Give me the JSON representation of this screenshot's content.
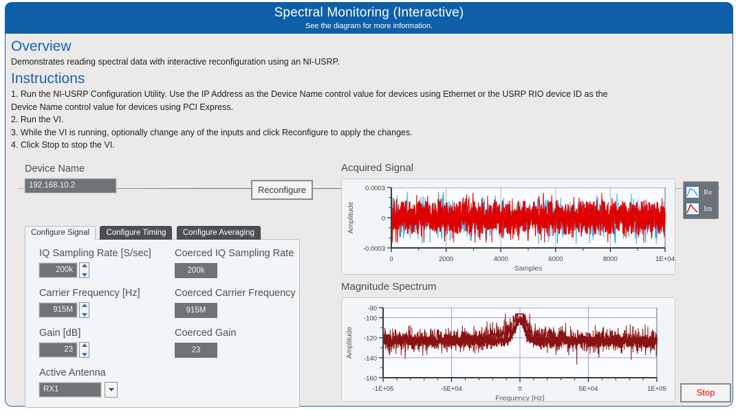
{
  "banner": {
    "title": "Spectral Monitoring (Interactive)",
    "subtitle": "See the diagram for more information."
  },
  "docs": {
    "overview_heading": "Overview",
    "overview_text": "Demonstrates reading spectral data with interactive reconfiguration using an NI-USRP.",
    "instructions_heading": "Instructions",
    "steps": [
      "1. Run the NI-USRP Configuration Utility. Use the IP Address as the Device Name control value for devices using Ethernet or the USRP RIO device ID as the",
      "Device Name control value for devices using PCI Express.",
      "2. Run the VI.",
      "3. While the VI is running, optionally change any of the inputs and click Reconfigure to apply the changes.",
      "4. Click Stop to stop the VI."
    ]
  },
  "controls": {
    "device_name_label": "Device Name",
    "device_name_value": "192.168.10.2",
    "reconfigure_label": "Reconfigure",
    "tabs": [
      {
        "label": "Configure Signal",
        "active": true
      },
      {
        "label": "Configure Timing",
        "active": false
      },
      {
        "label": "Configure Averaging",
        "active": false
      }
    ],
    "fields": [
      {
        "label": "IQ Sampling Rate [S/sec]",
        "value": "200k",
        "coerced_label": "Coerced IQ Sampling Rate",
        "coerced_value": "200k"
      },
      {
        "label": "Carrier Frequency [Hz]",
        "value": "915M",
        "coerced_label": "Coerced Carrier Frequency",
        "coerced_value": "915M"
      },
      {
        "label": "Gain [dB]",
        "value": "23",
        "coerced_label": "Coerced Gain",
        "coerced_value": "23"
      }
    ],
    "antenna_label": "Active Antenna",
    "antenna_value": "RX1"
  },
  "legend": {
    "re_label": "Re",
    "im_label": "Im"
  },
  "stop_label": "Stop",
  "colors": {
    "banner_blue": "#0c5fa8",
    "heading_blue": "#1a62b3",
    "panel_bg": "#eceae9",
    "control_gray": "#6e7378",
    "trace_re": "#29a8e0",
    "trace_im": "#e00000",
    "trace_spectrum": "#8a1212",
    "stop_red": "#ff0000"
  },
  "chart_data": [
    {
      "type": "line",
      "title": "Acquired Signal",
      "xlabel": "Samples",
      "ylabel": "Amplitude",
      "xlim": [
        0,
        10000
      ],
      "ylim": [
        -0.0003,
        0.0003
      ],
      "xticks": [
        0,
        2000,
        4000,
        6000,
        8000,
        10000
      ],
      "xticklabels": [
        "0",
        "2000",
        "4000",
        "6000",
        "8000",
        "1E+04"
      ],
      "yticks": [
        -0.0003,
        0,
        0.0003
      ],
      "yticklabels": [
        "-0.0003",
        "0",
        "0.0003"
      ],
      "grid": true,
      "legend_position": "right-outside",
      "series": [
        {
          "name": "Re",
          "color": "#29a8e0",
          "description": "Broadband noise, zero mean, peak amplitude approximately 0.00025"
        },
        {
          "name": "Im",
          "color": "#e00000",
          "description": "Broadband noise, zero mean, peak amplitude approximately 0.00028"
        }
      ]
    },
    {
      "type": "line",
      "title": "Magnitude Spectrum",
      "xlabel": "Frequency [Hz]",
      "ylabel": "Amplitude",
      "xlim": [
        -100000,
        100000
      ],
      "ylim": [
        -160,
        -90
      ],
      "xticks": [
        -100000,
        -50000,
        0,
        50000,
        100000
      ],
      "xticklabels": [
        "-1E+05",
        "-5E+04",
        "0",
        "5E+04",
        "1E+05"
      ],
      "yticks": [
        -160,
        -140,
        -120,
        -100,
        -90
      ],
      "yticklabels": [
        "-160",
        "-140",
        "-120",
        "-100",
        "-90"
      ],
      "grid": true,
      "series": [
        {
          "name": "Magnitude Spectrum",
          "color": "#8a1212",
          "noise_floor_db": -123,
          "peak_db": -97,
          "peak_frequency_hz": 0
        }
      ]
    }
  ]
}
